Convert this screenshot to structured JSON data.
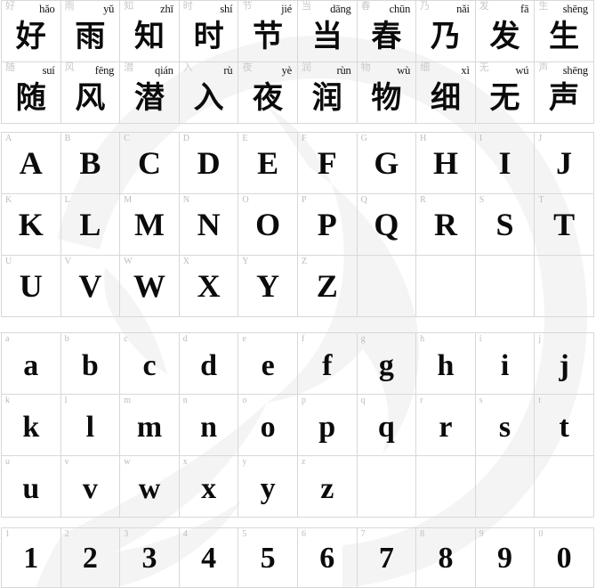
{
  "sheet": {
    "title": "Font specimen sheet",
    "background_color": "#ffffff",
    "grid_line_color": "#d8d8d8",
    "corner_label_color": "#bcbcbc",
    "glyph_color": "#0b0b0b",
    "watermark_color": "#f4f4f4",
    "columns": 10
  },
  "sections": {
    "cjk": {
      "name": "chinese-poem",
      "source_text": "好雨知时节，当春乃发生。随风潜入夜，润物细无声。",
      "rows": [
        [
          {
            "char": "好",
            "pinyin": "hǎo"
          },
          {
            "char": "雨",
            "pinyin": "yǔ"
          },
          {
            "char": "知",
            "pinyin": "zhī"
          },
          {
            "char": "时",
            "pinyin": "shí"
          },
          {
            "char": "节",
            "pinyin": "jié"
          },
          {
            "char": "当",
            "pinyin": "dāng"
          },
          {
            "char": "春",
            "pinyin": "chūn"
          },
          {
            "char": "乃",
            "pinyin": "nǎi"
          },
          {
            "char": "发",
            "pinyin": "fā"
          },
          {
            "char": "生",
            "pinyin": "shēng"
          }
        ],
        [
          {
            "char": "随",
            "pinyin": "suí"
          },
          {
            "char": "风",
            "pinyin": "fēng"
          },
          {
            "char": "潜",
            "pinyin": "qián"
          },
          {
            "char": "入",
            "pinyin": "rù"
          },
          {
            "char": "夜",
            "pinyin": "yè"
          },
          {
            "char": "润",
            "pinyin": "rùn"
          },
          {
            "char": "物",
            "pinyin": "wù"
          },
          {
            "char": "细",
            "pinyin": "xì"
          },
          {
            "char": "无",
            "pinyin": "wú"
          },
          {
            "char": "声",
            "pinyin": "shēng"
          }
        ]
      ]
    },
    "uppercase": {
      "name": "latin-uppercase",
      "rows": [
        [
          {
            "char": "A"
          },
          {
            "char": "B"
          },
          {
            "char": "C"
          },
          {
            "char": "D"
          },
          {
            "char": "E"
          },
          {
            "char": "F"
          },
          {
            "char": "G"
          },
          {
            "char": "H"
          },
          {
            "char": "I"
          },
          {
            "char": "J"
          }
        ],
        [
          {
            "char": "K"
          },
          {
            "char": "L"
          },
          {
            "char": "M"
          },
          {
            "char": "N"
          },
          {
            "char": "O"
          },
          {
            "char": "P"
          },
          {
            "char": "Q"
          },
          {
            "char": "R"
          },
          {
            "char": "S"
          },
          {
            "char": "T"
          }
        ],
        [
          {
            "char": "U"
          },
          {
            "char": "V"
          },
          {
            "char": "W"
          },
          {
            "char": "X"
          },
          {
            "char": "Y"
          },
          {
            "char": "Z"
          },
          {
            "char": ""
          },
          {
            "char": ""
          },
          {
            "char": ""
          },
          {
            "char": ""
          }
        ]
      ]
    },
    "lowercase": {
      "name": "latin-lowercase",
      "rows": [
        [
          {
            "char": "a"
          },
          {
            "char": "b"
          },
          {
            "char": "c"
          },
          {
            "char": "d"
          },
          {
            "char": "e"
          },
          {
            "char": "f"
          },
          {
            "char": "g"
          },
          {
            "char": "h"
          },
          {
            "char": "i"
          },
          {
            "char": "j"
          }
        ],
        [
          {
            "char": "k"
          },
          {
            "char": "l"
          },
          {
            "char": "m"
          },
          {
            "char": "n"
          },
          {
            "char": "o"
          },
          {
            "char": "p"
          },
          {
            "char": "q"
          },
          {
            "char": "r"
          },
          {
            "char": "s"
          },
          {
            "char": "t"
          }
        ],
        [
          {
            "char": "u"
          },
          {
            "char": "v"
          },
          {
            "char": "w"
          },
          {
            "char": "x"
          },
          {
            "char": "y"
          },
          {
            "char": "z"
          },
          {
            "char": ""
          },
          {
            "char": ""
          },
          {
            "char": ""
          },
          {
            "char": ""
          }
        ]
      ]
    },
    "digits": {
      "name": "digits",
      "rows": [
        [
          {
            "char": "1"
          },
          {
            "char": "2"
          },
          {
            "char": "3"
          },
          {
            "char": "4"
          },
          {
            "char": "5"
          },
          {
            "char": "6"
          },
          {
            "char": "7"
          },
          {
            "char": "8"
          },
          {
            "char": "9"
          },
          {
            "char": "0"
          }
        ]
      ]
    }
  }
}
